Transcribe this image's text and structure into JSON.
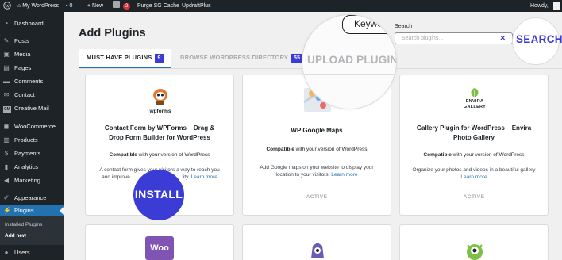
{
  "admin_bar": {
    "site_name": "My WordPress",
    "comments_count": "0",
    "new_label": "New",
    "yoast_badge": "2",
    "purge_label": "Purge SG Cache",
    "updraft_label": "UpdraftPlus",
    "howdy": "Howdy,"
  },
  "sidebar": {
    "items": [
      {
        "label": "Dashboard",
        "icon": "dashboard-icon"
      },
      {
        "label": "Posts",
        "icon": "pin-icon"
      },
      {
        "label": "Media",
        "icon": "media-icon"
      },
      {
        "label": "Pages",
        "icon": "page-icon"
      },
      {
        "label": "Comments",
        "icon": "comment-icon"
      },
      {
        "label": "Contact",
        "icon": "mail-icon"
      },
      {
        "label": "Creative Mail",
        "icon": "cm-icon"
      },
      {
        "label": "WooCommerce",
        "icon": "woo-icon"
      },
      {
        "label": "Products",
        "icon": "products-icon"
      },
      {
        "label": "Payments",
        "icon": "payments-icon"
      },
      {
        "label": "Analytics",
        "icon": "analytics-icon"
      },
      {
        "label": "Marketing",
        "icon": "megaphone-icon"
      },
      {
        "label": "Appearance",
        "icon": "brush-icon"
      },
      {
        "label": "Plugins",
        "icon": "plug-icon"
      },
      {
        "label": "Users",
        "icon": "user-icon"
      }
    ],
    "submenu": {
      "installed": "Installed Plugins",
      "add_new": "Add new"
    },
    "cm_badge": "CM"
  },
  "page": {
    "title": "Add Plugins",
    "tabs": [
      {
        "label": "MUST HAVE PLUGINS",
        "count": "9"
      },
      {
        "label": "BROWSE WORDPRESS DIRECTORY",
        "count": "55"
      }
    ],
    "search_label": "Search",
    "search_placeholder": "Search plugins...",
    "search_clear": "✕"
  },
  "cards": [
    {
      "logo_text": "wpforms",
      "title": "Contact Form by WPForms – Drag & Drop Form Builder for WordPress",
      "compat_bold": "Compatible",
      "compat_rest": " with your version of WordPress",
      "desc_start": "A contact form gives your visitors a way to reach you",
      "desc_end": "and improve",
      "desc_end2": "lity.",
      "learn": "Learn more"
    },
    {
      "title": "WP Google Maps",
      "compat_bold": "Compatible",
      "compat_rest": " with your version of WordPress",
      "desc_start": "Add Google maps on your website to display your",
      "desc_end": "location to your visitors.",
      "learn": "Learn more",
      "status": "ACTIVE"
    },
    {
      "logo_text": "ENVIRA GALLERY",
      "title": "Gallery Plugin for WordPress – Envira Photo Gallery",
      "compat_bold": "Compatible",
      "compat_rest": " with your version of WordPress",
      "desc_start": "Organize your photos and videos in a beautiful gallery",
      "learn": "Learn more",
      "status": "ACTIVE"
    },
    {
      "logo_text": "Woo"
    }
  ],
  "overlays": {
    "upload_plugin": "UPLOAD PLUGIN",
    "keyword": "Keywor",
    "search": "SEARCH",
    "install": "INSTALL"
  },
  "colors": {
    "accent": "#3b3bd6",
    "wp_blue": "#2271b1",
    "admin_dark": "#1d2327"
  }
}
